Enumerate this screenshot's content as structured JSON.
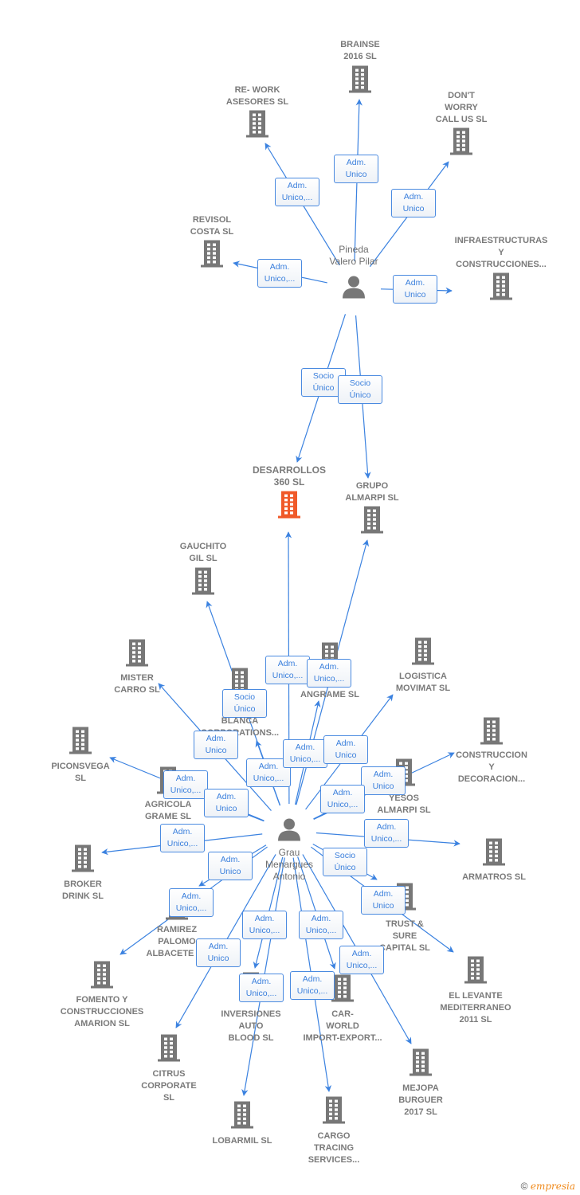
{
  "colors": {
    "edge": "#3b82e0",
    "node": "#777777",
    "highlight": "#f05a2a"
  },
  "persons": [
    {
      "id": "p1",
      "name": [
        "Pineda",
        "Valero Pilar"
      ],
      "icon": "person-icon"
    },
    {
      "id": "p2",
      "name": [
        "Grau",
        "Menargues",
        "Antonio"
      ],
      "icon": "person-icon"
    }
  ],
  "companies": [
    {
      "id": "brainse",
      "name": [
        "BRAINSE",
        "2016  SL"
      ]
    },
    {
      "id": "rework",
      "name": [
        "RE- WORK",
        "ASESORES  SL"
      ]
    },
    {
      "id": "dontworry",
      "name": [
        "DON'T",
        "WORRY",
        "CALL US  SL"
      ]
    },
    {
      "id": "revisol",
      "name": [
        "REVISOL",
        "COSTA  SL"
      ]
    },
    {
      "id": "infra",
      "name": [
        "INFRAESTRUCTURAS",
        "Y",
        "CONSTRUCCIONES..."
      ]
    },
    {
      "id": "desarrollos",
      "name": [
        "DESARROLLOS",
        "360  SL"
      ],
      "highlighted": true
    },
    {
      "id": "grupo",
      "name": [
        "GRUPO",
        "ALMARPI  SL"
      ]
    },
    {
      "id": "gauchito",
      "name": [
        "GAUCHITO",
        "GIL SL"
      ]
    },
    {
      "id": "mister",
      "name": [
        "MISTER",
        "CARRO SL"
      ]
    },
    {
      "id": "casablanca",
      "name": [
        "C...",
        "BLANCA",
        "CORPORATIONS..."
      ]
    },
    {
      "id": "angrame",
      "name": [
        "CA...ES",
        "ANGRAME  SL"
      ]
    },
    {
      "id": "logistica",
      "name": [
        "LOGISTICA",
        "MOVIMAT  SL"
      ]
    },
    {
      "id": "piconsvega",
      "name": [
        "PICONSVEGA",
        "SL"
      ]
    },
    {
      "id": "construccion",
      "name": [
        "CONSTRUCCION",
        "Y",
        "DECORACION..."
      ]
    },
    {
      "id": "agricola",
      "name": [
        "AGRICOLA",
        "GRAME SL"
      ]
    },
    {
      "id": "yesos",
      "name": [
        "YESOS",
        "ALMARPI SL"
      ]
    },
    {
      "id": "broker",
      "name": [
        "BROKER",
        "DRINK SL"
      ]
    },
    {
      "id": "armatros",
      "name": [
        "ARMATROS  SL"
      ]
    },
    {
      "id": "ramirez",
      "name": [
        "RAMIREZ",
        "PALOMO",
        "ALBACETE  SL"
      ]
    },
    {
      "id": "trust",
      "name": [
        "TRUST &",
        "SURE",
        "CAPITAL  SL"
      ]
    },
    {
      "id": "fomento",
      "name": [
        "FOMENTO Y",
        "CONSTRUCCIONES",
        "AMARION  SL"
      ]
    },
    {
      "id": "levante",
      "name": [
        "EL LEVANTE",
        "MEDITERRANEO",
        "2011 SL"
      ]
    },
    {
      "id": "inversiones",
      "name": [
        "INVERSIONES",
        "AUTO",
        "BLOOD  SL"
      ]
    },
    {
      "id": "carworld",
      "name": [
        "CAR-",
        "WORLD",
        "IMPORT-EXPORT..."
      ]
    },
    {
      "id": "citrus",
      "name": [
        "CITRUS",
        "CORPORATE",
        "SL"
      ]
    },
    {
      "id": "mejopa",
      "name": [
        "MEJOPA",
        "BURGUER",
        "2017  SL"
      ]
    },
    {
      "id": "lobarmil",
      "name": [
        "LOBARMIL  SL"
      ]
    },
    {
      "id": "cargo",
      "name": [
        "CARGO",
        "TRACING",
        "SERVICES..."
      ]
    }
  ],
  "edges": [
    {
      "from": "p1",
      "to": "brainse",
      "role": [
        "Adm.",
        "Unico"
      ]
    },
    {
      "from": "p1",
      "to": "rework",
      "role": [
        "Adm.",
        "Unico,..."
      ]
    },
    {
      "from": "p1",
      "to": "dontworry",
      "role": [
        "Adm.",
        "Unico"
      ]
    },
    {
      "from": "p1",
      "to": "revisol",
      "role": [
        "Adm.",
        "Unico,..."
      ]
    },
    {
      "from": "p1",
      "to": "infra",
      "role": [
        "Adm.",
        "Unico"
      ]
    },
    {
      "from": "p1",
      "to": "desarrollos",
      "role": [
        "Socio",
        "Único"
      ]
    },
    {
      "from": "p1",
      "to": "grupo",
      "role": [
        "Socio",
        "Único"
      ]
    },
    {
      "from": "p2",
      "to": "desarrollos",
      "role": [
        "Adm.",
        "Unico,..."
      ]
    },
    {
      "from": "p2",
      "to": "grupo",
      "role": [
        "Adm.",
        "Unico,..."
      ]
    },
    {
      "from": "p2",
      "to": "gauchito",
      "role": [
        "Socio",
        "Único"
      ]
    },
    {
      "from": "p2",
      "to": "mister",
      "role": [
        "Adm.",
        "Unico"
      ]
    },
    {
      "from": "p2",
      "to": "casablanca",
      "role": [
        "Adm.",
        "Unico,..."
      ]
    },
    {
      "from": "p2",
      "to": "angrame",
      "role": [
        "Adm.",
        "Unico,..."
      ]
    },
    {
      "from": "p2",
      "to": "logistica",
      "role": [
        "Adm.",
        "Unico"
      ]
    },
    {
      "from": "p2",
      "to": "piconsvega",
      "role": [
        "Adm.",
        "Unico,..."
      ]
    },
    {
      "from": "p2",
      "to": "agricola",
      "role": [
        "Adm.",
        "Unico"
      ]
    },
    {
      "from": "p2",
      "to": "construccion",
      "role": [
        "Adm.",
        "Unico"
      ]
    },
    {
      "from": "p2",
      "to": "yesos",
      "role": [
        "Adm.",
        "Unico,..."
      ]
    },
    {
      "from": "p2",
      "to": "broker",
      "role": [
        "Adm.",
        "Unico,..."
      ]
    },
    {
      "from": "p2",
      "to": "armatros",
      "role": [
        "Adm.",
        "Unico,..."
      ]
    },
    {
      "from": "p2",
      "to": "ramirez",
      "role": [
        "Adm.",
        "Unico"
      ]
    },
    {
      "from": "p2",
      "to": "fomento",
      "role": [
        "Adm.",
        "Unico,..."
      ]
    },
    {
      "from": "p2",
      "to": "trust",
      "role": [
        "Socio",
        "Único"
      ]
    },
    {
      "from": "p2",
      "to": "levante",
      "role": [
        "Adm.",
        "Unico"
      ]
    },
    {
      "from": "p2",
      "to": "citrus",
      "role": [
        "Adm.",
        "Unico"
      ]
    },
    {
      "from": "p2",
      "to": "inversiones",
      "role": [
        "Adm.",
        "Unico,..."
      ]
    },
    {
      "from": "p2",
      "to": "lobarmil",
      "role": [
        "Adm.",
        "Unico,..."
      ]
    },
    {
      "from": "p2",
      "to": "carworld",
      "role": [
        "Adm.",
        "Unico,..."
      ]
    },
    {
      "from": "p2",
      "to": "cargo",
      "role": [
        "Adm.",
        "Unico,..."
      ]
    },
    {
      "from": "p2",
      "to": "mejopa",
      "role": [
        "Adm.",
        "Unico,..."
      ]
    }
  ],
  "footer": {
    "copyright": "©",
    "brand": "empresia"
  }
}
